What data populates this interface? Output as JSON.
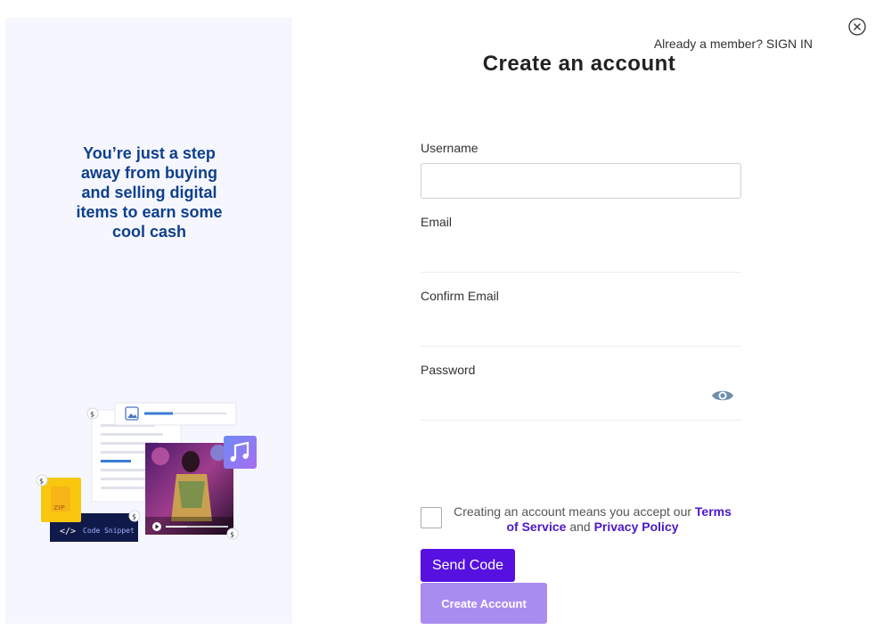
{
  "left_panel": {
    "tagline": "You’re just a step away from buying and selling digital items to earn some cool cash",
    "illustration": {
      "badge_symbol": "$",
      "zip_label": "ZIP",
      "code_label": "Code Snippet",
      "code_tag": "</>"
    }
  },
  "header": {
    "signin_prompt": "Already a member?",
    "signin_link": "SIGN IN",
    "title": "Create an account"
  },
  "form": {
    "username_label": "Username",
    "email_label": "Email",
    "confirm_email_label": "Confirm Email",
    "password_label": "Password",
    "username_value": "",
    "email_value": "",
    "confirm_email_value": "",
    "password_value": ""
  },
  "terms": {
    "prefix": "Creating an account means you accept our",
    "terms_link": "Terms of Service",
    "middle": "and",
    "privacy_link": "Privacy Policy"
  },
  "buttons": {
    "send_code": "Send Code",
    "create_account": "Create Account"
  },
  "colors": {
    "accent": "#5610e0",
    "accent_light": "#a98cf0",
    "tagline": "#0e3f8c",
    "panel_bg": "#f6f7fe"
  },
  "icons": [
    "close-icon",
    "eye-icon",
    "image-icon",
    "music-icon",
    "play-icon",
    "zip-file-icon"
  ]
}
